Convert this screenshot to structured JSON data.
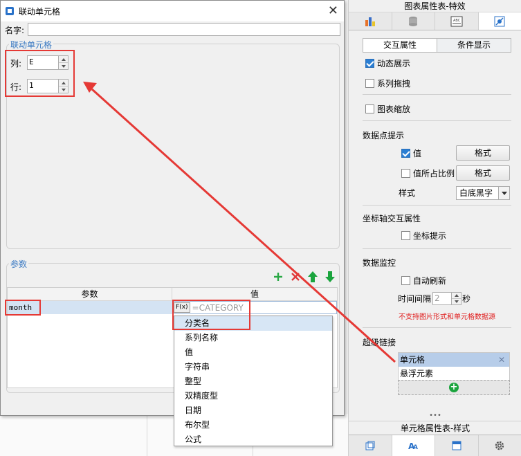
{
  "right_panel": {
    "title": "图表属性表-特效",
    "icon_tabs": [
      "chart-type-icon",
      "data-icon",
      "style-icon",
      "effects-icon"
    ],
    "sub_tabs": [
      {
        "label": "交互属性",
        "active": true
      },
      {
        "label": "条件显示",
        "active": false
      }
    ],
    "dynamic_show": {
      "label": "动态展示",
      "checked": true
    },
    "series_drag": {
      "label": "系列拖拽",
      "checked": false
    },
    "chart_zoom": {
      "label": "图表缩放",
      "checked": false
    },
    "datapoint_tip": {
      "header": "数据点提示",
      "value": {
        "label": "值",
        "checked": true,
        "button": "格式"
      },
      "percent": {
        "label": "值所占比例",
        "checked": false,
        "button": "格式"
      },
      "style_label": "样式",
      "style_value": "白底黑字"
    },
    "axis_interaction": {
      "header": "坐标轴交互属性",
      "axis_tip": {
        "label": "坐标提示",
        "checked": false
      }
    },
    "data_monitor": {
      "header": "数据监控",
      "auto_refresh": {
        "label": "自动刷新",
        "checked": false
      },
      "interval_label": "时间间隔",
      "interval_value": "2",
      "interval_unit": "秒",
      "warning": "不支持图片形式和单元格数据源"
    },
    "hyperlink": {
      "header": "超级链接",
      "items": [
        {
          "label": "单元格",
          "selected": true
        },
        {
          "label": "悬浮元素",
          "selected": false
        }
      ]
    },
    "bottom_dots": "•••",
    "bottom_title": "单元格属性表-样式",
    "bottom_tabs": [
      "cell-element-icon",
      "font-style-icon",
      "widget-icon",
      "settings-icon"
    ]
  },
  "dialog": {
    "title": "联动单元格",
    "name_label": "名字:",
    "name_value": "",
    "linked_cell": {
      "legend": "联动单元格",
      "col_label": "列:",
      "col_value": "E",
      "row_label": "行:",
      "row_value": "1"
    },
    "params": {
      "legend": "参数",
      "headers": [
        "参数",
        "值"
      ],
      "rows": [
        {
          "param": "month",
          "formula_badge": "F(x)",
          "value_placeholder": "=CATEGORY"
        }
      ]
    },
    "dropdown_options": [
      "分类名",
      "系列名称",
      "值",
      "字符串",
      "整型",
      "双精度型",
      "日期",
      "布尔型",
      "公式"
    ]
  },
  "colors": {
    "accent": "#3a79c2",
    "highlight_red": "#e53935",
    "warning": "#e02020",
    "add_green": "#1aa43d"
  }
}
